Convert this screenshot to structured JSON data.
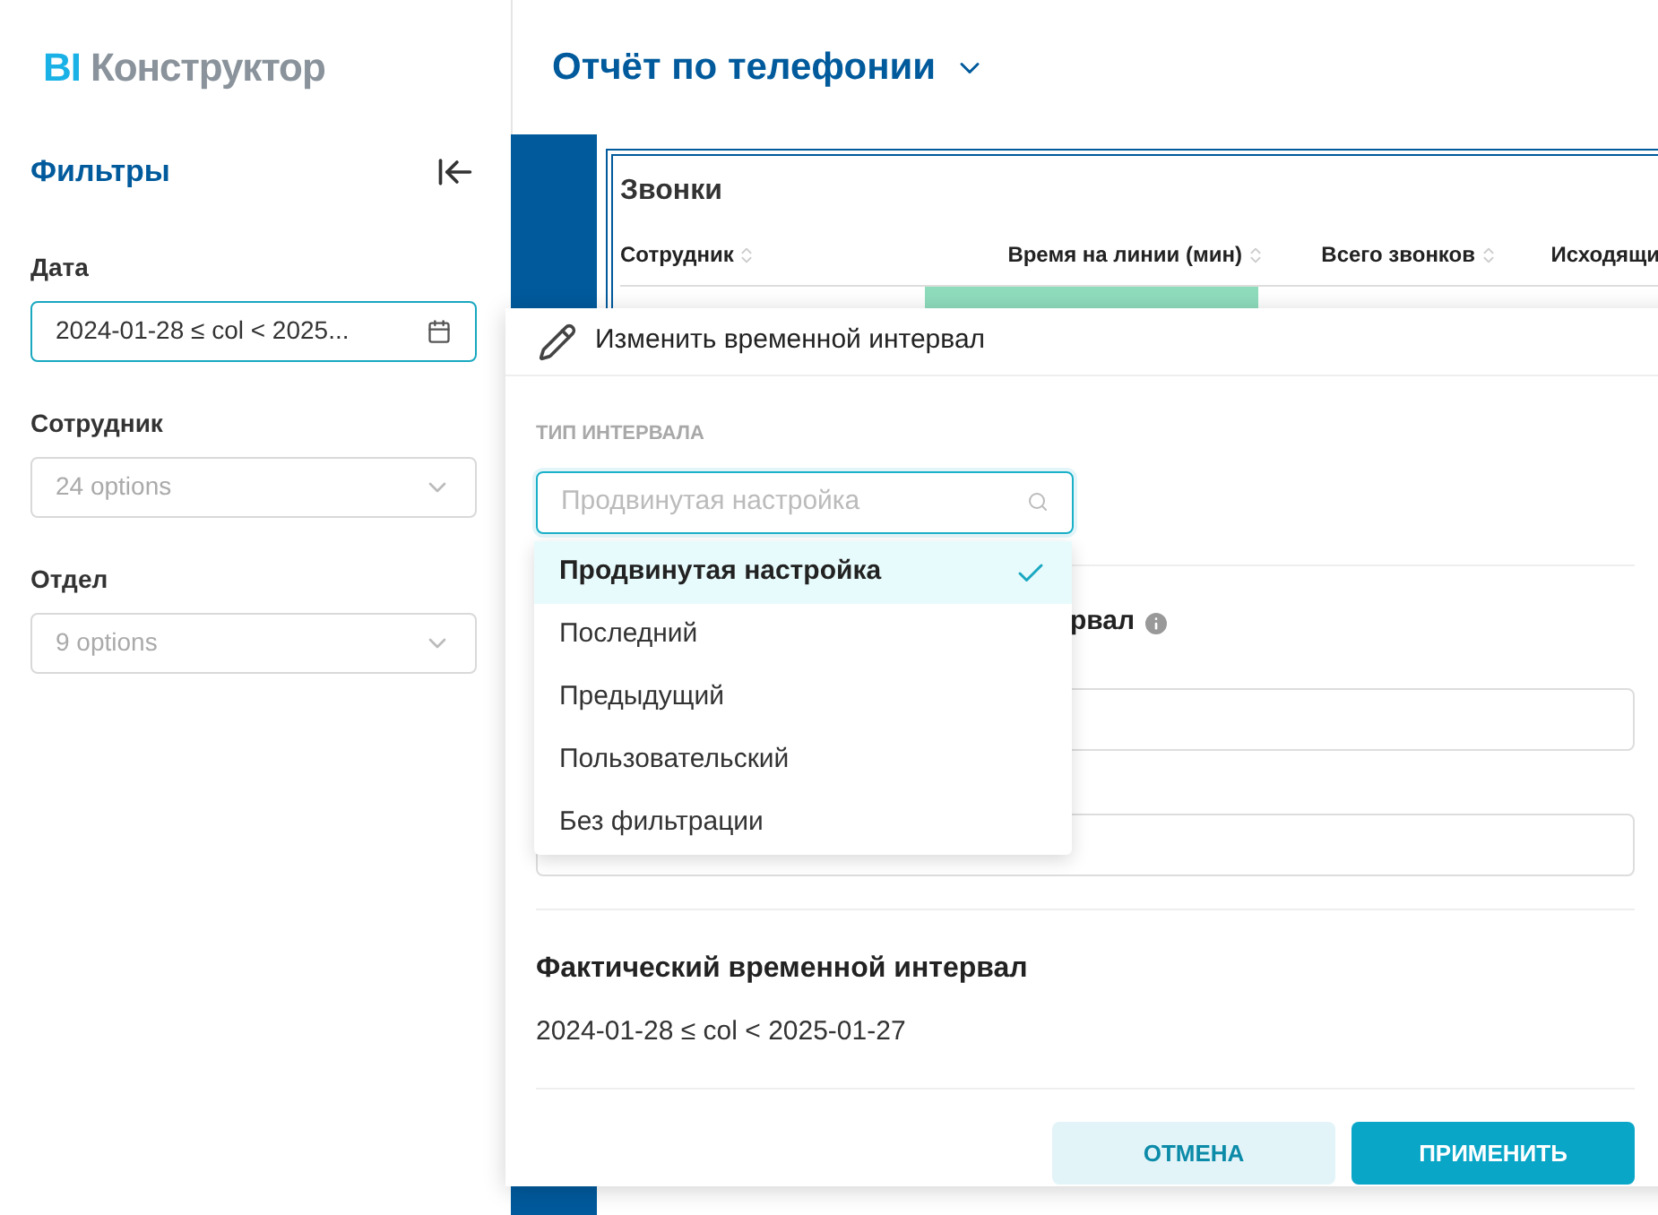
{
  "logo": {
    "mark": "BI",
    "name": "Конструктор"
  },
  "report": {
    "title": "Отчёт по телефонии"
  },
  "filters": {
    "title": "Фильтры",
    "fields": [
      {
        "label": "Дата",
        "kind": "date",
        "value": "2024-01-28 ≤ col < 2025...",
        "focused": true
      },
      {
        "label": "Сотрудник",
        "kind": "select",
        "placeholder": "24 options",
        "focused": false
      },
      {
        "label": "Отдел",
        "kind": "select",
        "placeholder": "9 options",
        "focused": false
      }
    ]
  },
  "table": {
    "title": "Звонки",
    "columns": [
      {
        "label": "Сотрудник"
      },
      {
        "label": "Время на линии (мин)"
      },
      {
        "label": "Всего звонков"
      },
      {
        "label": "Исходящи"
      }
    ],
    "first_row_highlight": true
  },
  "popover": {
    "title": "Изменить временной интервал",
    "type_label": "ТИП ИНТЕРВАЛА",
    "type_placeholder": "Продвинутая настройка",
    "options": [
      {
        "label": "Продвинутая настройка",
        "selected": true
      },
      {
        "label": "Последний",
        "selected": false
      },
      {
        "label": "Предыдущий",
        "selected": false
      },
      {
        "label": "Пользовательский",
        "selected": false
      },
      {
        "label": "Без фильтрации",
        "selected": false
      }
    ],
    "section_label_tail": "рвал",
    "actual_title": "Фактический временной интервал",
    "actual_value": "2024-01-28 ≤ col < 2025-01-27",
    "cancel": "ОТМЕНА",
    "apply": "ПРИМЕНИТЬ"
  }
}
